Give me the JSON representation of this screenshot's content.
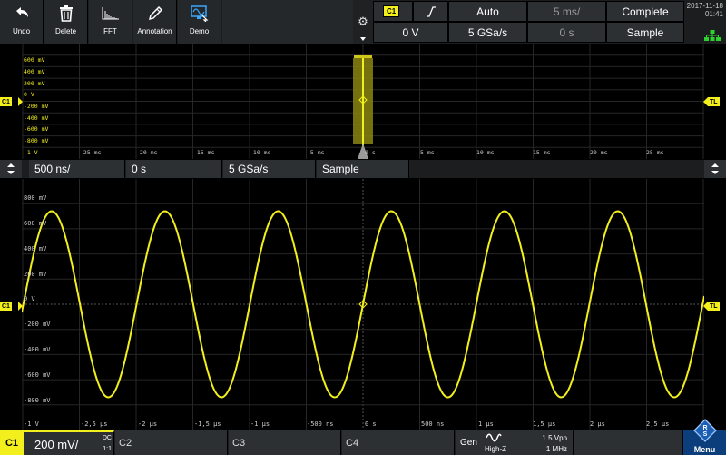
{
  "toolbar": {
    "undo": "Undo",
    "delete": "Delete",
    "fft": "FFT",
    "annotation": "Annotation",
    "demo": "Demo"
  },
  "trigger": {
    "source": "C1",
    "mode": "Auto",
    "level": "0 V",
    "sample_rate": "5 GSa/s",
    "holdoff_dim": "5 ms/",
    "position_dim": "0 s",
    "acq_state": "Complete",
    "acq_mode": "Sample"
  },
  "datetime": {
    "date": "2017-11-18",
    "time": "01:41"
  },
  "zoom_info": {
    "timebase": "500 ns/",
    "position": "0 s",
    "sample_rate": "5 GSa/s",
    "mode": "Sample"
  },
  "markers": {
    "channel": "C1",
    "trigger_level": "TL"
  },
  "overview_plot": {
    "y_labels": [
      "600 mV",
      "400 mV",
      "200 mV",
      "0 V",
      "-200 mV",
      "-400 mV",
      "-600 mV",
      "-800 mV",
      "-1 V"
    ],
    "x_labels": [
      "-25 ms",
      "-20 ms",
      "-15 ms",
      "-10 ms",
      "-5 ms",
      "0 s",
      "5 ms",
      "10 ms",
      "15 ms",
      "20 ms",
      "25 ms"
    ]
  },
  "main_plot": {
    "y_labels": [
      "800 mV",
      "600 mV",
      "400 mV",
      "200 mV",
      "0 V",
      "-200 mV",
      "-400 mV",
      "-600 mV",
      "-800 mV",
      "-1 V"
    ],
    "x_labels": [
      "-2,5 µs",
      "-2 µs",
      "-1,5 µs",
      "-1 µs",
      "-500 ns",
      "0 s",
      "500 ns",
      "1 µs",
      "1,5 µs",
      "2 µs",
      "2,5 µs"
    ]
  },
  "chart_data": {
    "type": "line",
    "title": "",
    "xlabel": "",
    "ylabel": "",
    "x_unit": "µs",
    "y_unit": "mV",
    "xlim": [
      -3.0,
      3.0
    ],
    "ylim": [
      -1000,
      900
    ],
    "grid": true,
    "series": [
      {
        "amplitude_mV": 740,
        "period_us": 0.998,
        "phase_at_zero": 0
      }
    ],
    "color": "#f2ef1d"
  },
  "status": {
    "channel": "C1",
    "scale": "200 mV/",
    "coupling": "DC",
    "probe": "1:1",
    "c2": "C2",
    "c3": "C3",
    "c4": "C4",
    "gen": "Gen",
    "gen_load": "High-Z",
    "gen_amplitude": "1.5 Vpp",
    "gen_freq": "1 MHz",
    "menu": "Menu"
  },
  "colors": {
    "trace": "#f2ef1d",
    "grid": "#2a2a2a",
    "panel": "#2d3033",
    "accent": "#0b3e7a"
  }
}
